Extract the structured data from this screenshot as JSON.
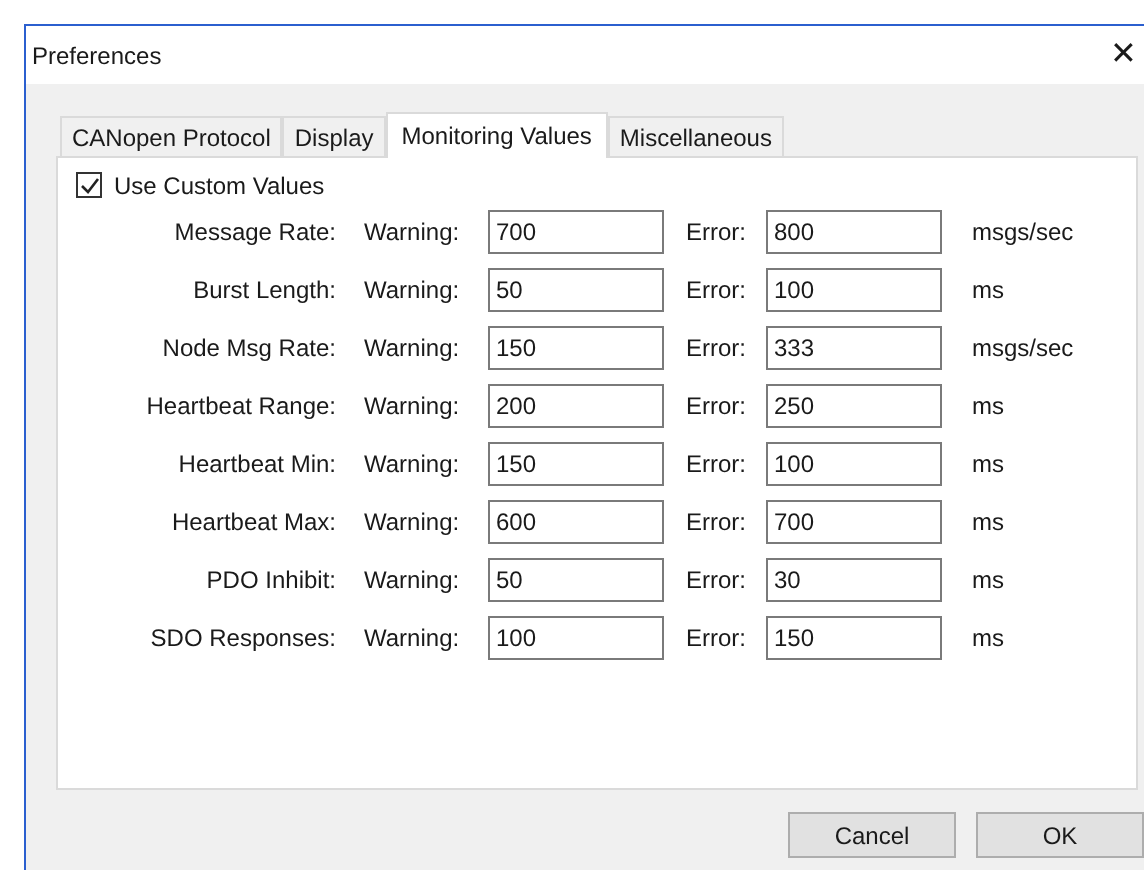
{
  "window": {
    "title": "Preferences",
    "close": "✕"
  },
  "tabs": [
    {
      "label": "CANopen Protocol",
      "selected": false
    },
    {
      "label": "Display",
      "selected": false
    },
    {
      "label": "Monitoring Values",
      "selected": true
    },
    {
      "label": "Miscellaneous",
      "selected": false
    }
  ],
  "use_custom_values": {
    "label": "Use Custom Values",
    "checked": true
  },
  "rows": [
    {
      "label": "Message Rate:",
      "warning_label": "Warning:",
      "warning": "700",
      "error_label": "Error:",
      "error": "800",
      "unit": "msgs/sec"
    },
    {
      "label": "Burst Length:",
      "warning_label": "Warning:",
      "warning": "50",
      "error_label": "Error:",
      "error": "100",
      "unit": "ms"
    },
    {
      "label": "Node Msg Rate:",
      "warning_label": "Warning:",
      "warning": "150",
      "error_label": "Error:",
      "error": "333",
      "unit": "msgs/sec"
    },
    {
      "label": "Heartbeat Range:",
      "warning_label": "Warning:",
      "warning": "200",
      "error_label": "Error:",
      "error": "250",
      "unit": "ms"
    },
    {
      "label": "Heartbeat Min:",
      "warning_label": "Warning:",
      "warning": "150",
      "error_label": "Error:",
      "error": "100",
      "unit": "ms"
    },
    {
      "label": "Heartbeat Max:",
      "warning_label": "Warning:",
      "warning": "600",
      "error_label": "Error:",
      "error": "700",
      "unit": "ms"
    },
    {
      "label": "PDO Inhibit:",
      "warning_label": "Warning:",
      "warning": "50",
      "error_label": "Error:",
      "error": "30",
      "unit": "ms"
    },
    {
      "label": "SDO Responses:",
      "warning_label": "Warning:",
      "warning": "100",
      "error_label": "Error:",
      "error": "150",
      "unit": "ms"
    }
  ],
  "buttons": [
    "Cancel",
    "OK"
  ]
}
